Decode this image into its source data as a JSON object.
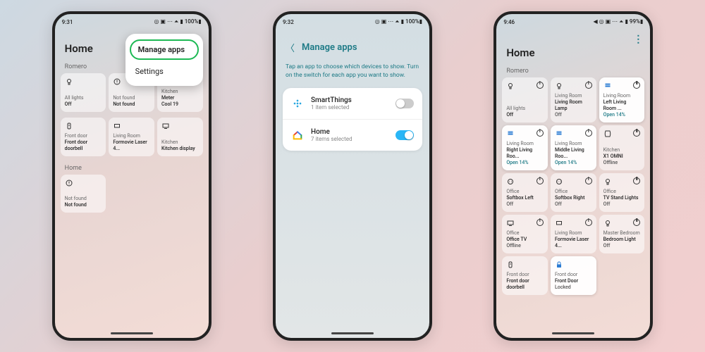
{
  "phone1": {
    "time": "9:31",
    "status_icons": "◎ ▣ ⋯ ⏶ ▮ 100%▮",
    "title": "Home",
    "section": "Romero",
    "menu": {
      "manage": "Manage apps",
      "settings": "Settings"
    },
    "tiles_a": [
      {
        "icon": "bulb",
        "l1": "All lights",
        "l2": "Off"
      },
      {
        "icon": "alert",
        "l1": "Not found",
        "l2": "Not found"
      },
      {
        "icon": "thermo",
        "l1": "Kitchen",
        "l2": "Meter",
        "l3": "Cool 19"
      }
    ],
    "tiles_b": [
      {
        "icon": "doorbell",
        "l1": "Front door",
        "l2": "Front door doorbell"
      },
      {
        "icon": "tv-sm",
        "l1": "Living Room",
        "l2": "Formovie Laser 4..."
      },
      {
        "icon": "tv",
        "l1": "Kitchen",
        "l2": "Kitchen display"
      }
    ],
    "section2": "Home",
    "tiles_c": [
      {
        "icon": "alert",
        "l1": "Not found",
        "l2": "Not found"
      }
    ]
  },
  "phone2": {
    "time": "9:32",
    "status_icons": "◎ ▣ ⋯ ⏶ ▮ 100%▮",
    "header": "Manage apps",
    "desc": "Tap an app to choose which devices to show. Turn on the switch for each app you want to show.",
    "apps": [
      {
        "name": "SmartThings",
        "sub": "1 item selected",
        "icon": "st",
        "on": false
      },
      {
        "name": "Home",
        "sub": "7 items selected",
        "icon": "gh",
        "on": true
      }
    ]
  },
  "phone3": {
    "time": "9:46",
    "status_icons": "◀ ◎ ▣ ⋯ ⏶ ▮ 99%▮",
    "title": "Home",
    "section": "Romero",
    "tiles": [
      {
        "icon": "bulb",
        "l1": "All lights",
        "l2": "Off",
        "pow": true
      },
      {
        "icon": "bulb",
        "l1": "Living Room",
        "l2": "Living Room Lamp",
        "stat": "Off",
        "pow": true
      },
      {
        "icon": "blinds",
        "l1": "Living Room",
        "l2": "Left Living Room ...",
        "stat": "Open 14%",
        "pow": true,
        "hl": true
      },
      {
        "icon": "blinds",
        "l1": "Living Room",
        "l2": "Right Living Roo...",
        "stat": "Open 14%",
        "pow": true,
        "hl": true
      },
      {
        "icon": "blinds",
        "l1": "Living Room",
        "l2": "Middle Living Roo...",
        "stat": "Open 14%",
        "pow": true,
        "hl": true
      },
      {
        "icon": "speaker",
        "l1": "Kitchen",
        "l2": "X1 OMNI",
        "stat": "Offline",
        "pow": true
      },
      {
        "icon": "plug",
        "l1": "Office",
        "l2": "Softbox Left",
        "stat": "Off",
        "pow": true
      },
      {
        "icon": "plug",
        "l1": "Office",
        "l2": "Softbox Right",
        "stat": "Off",
        "pow": true
      },
      {
        "icon": "bulb",
        "l1": "Office",
        "l2": "TV Stand Lights",
        "stat": "Off",
        "pow": true
      },
      {
        "icon": "tv",
        "l1": "Office",
        "l2": "Office TV",
        "stat": "Offline",
        "pow": true
      },
      {
        "icon": "tv-sm",
        "l1": "Living Room",
        "l2": "Formovie Laser 4...",
        "stat": "",
        "pow": true
      },
      {
        "icon": "bulb",
        "l1": "Master Bedroom",
        "l2": "Bedroom Light",
        "stat": "Off",
        "pow": true
      },
      {
        "icon": "doorbell",
        "l1": "Front door",
        "l2": "Front door doorbell",
        "stat": "",
        "pow": false
      },
      {
        "icon": "lock",
        "l1": "Front door",
        "l2": "Front Door",
        "stat": "Locked",
        "pow": false,
        "hl": true
      }
    ]
  }
}
